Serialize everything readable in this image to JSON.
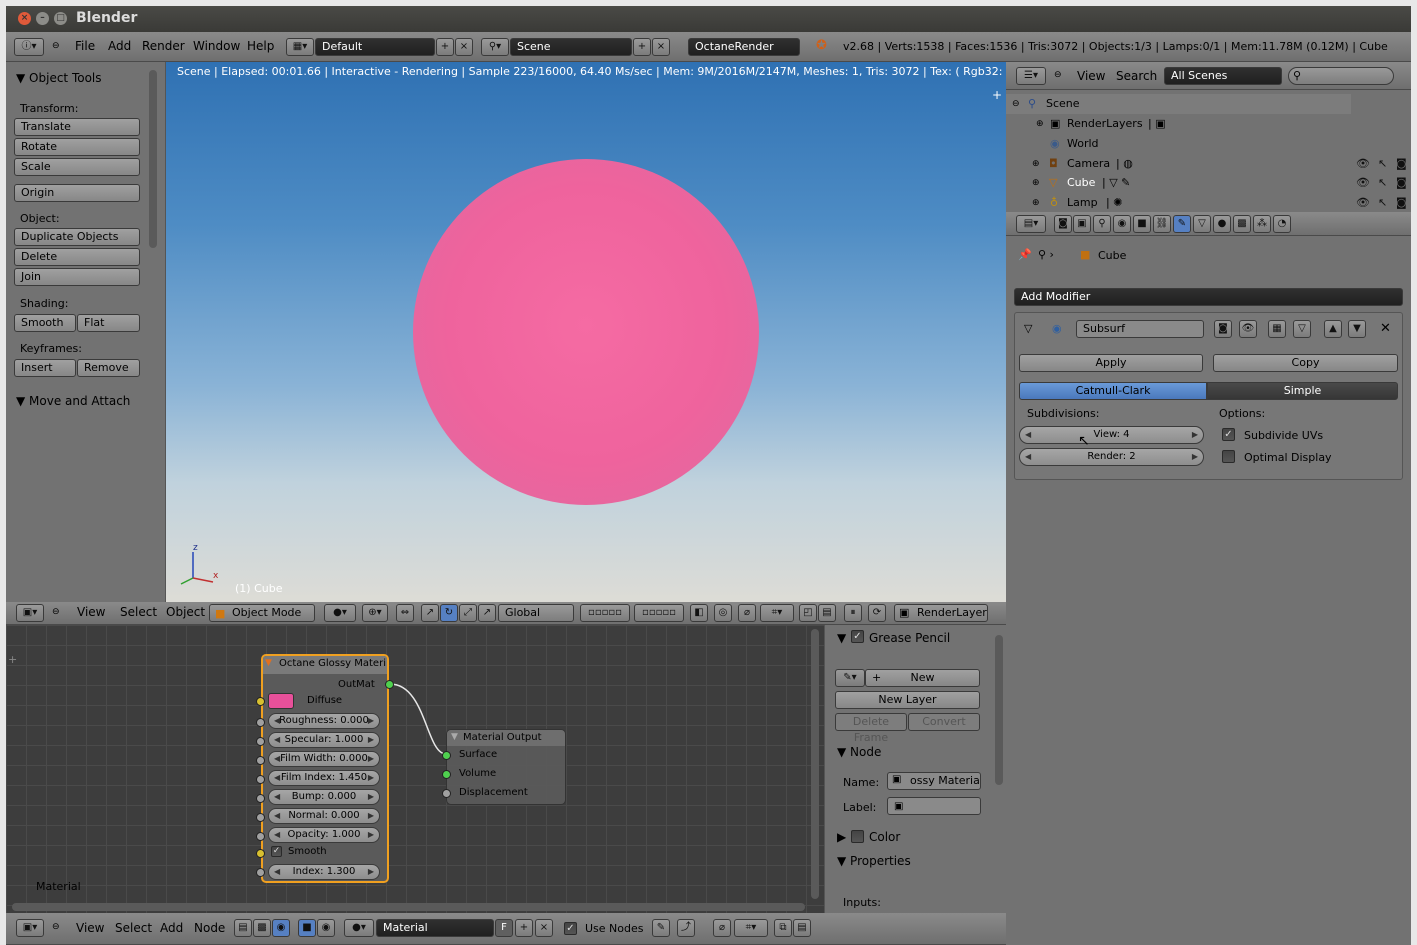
{
  "app": {
    "title": "Blender"
  },
  "topbar": {
    "menus": [
      "File",
      "Add",
      "Render",
      "Window",
      "Help"
    ],
    "screen_layout": "Default",
    "scene": "Scene",
    "render_engine": "OctaneRender",
    "stats": "v2.68 | Verts:1538 | Faces:1536 | Tris:3072 | Objects:1/3 | Lamps:0/1 | Mem:11.78M (0.12M) | Cube"
  },
  "tools_panel": {
    "title": "Object Tools",
    "transform_label": "Transform:",
    "translate": "Translate",
    "rotate": "Rotate",
    "scale": "Scale",
    "origin": "Origin",
    "object_label": "Object:",
    "duplicate": "Duplicate Objects",
    "delete": "Delete",
    "join": "Join",
    "shading_label": "Shading:",
    "smooth": "Smooth",
    "flat": "Flat",
    "keyframes_label": "Keyframes:",
    "insert": "Insert",
    "remove": "Remove",
    "move_attach": "Move and Attach"
  },
  "viewport": {
    "status": "Scene | Elapsed: 00:01.66 | Interactive - Rendering | Sample 223/16000, 64.40 Ms/sec | Mem: 9M/2016M/2147M, Meshes: 1, Tris: 3072 | Tex: ( Rgb32: 0/144, Rgb64",
    "object_label": "(1) Cube",
    "sphere_color": "#f06aa0",
    "axis_x": "x",
    "axis_z": "z"
  },
  "viewport_header": {
    "menus": [
      "View",
      "Select",
      "Object"
    ],
    "mode": "Object Mode",
    "orientation": "Global",
    "render_layer": "RenderLayer"
  },
  "outliner": {
    "menus": [
      "View",
      "Search"
    ],
    "filter": "All Scenes",
    "items": [
      {
        "label": "Scene"
      },
      {
        "label": "RenderLayers"
      },
      {
        "label": "World"
      },
      {
        "label": "Camera"
      },
      {
        "label": "Cube"
      },
      {
        "label": "Lamp"
      }
    ]
  },
  "properties": {
    "context_object": "Cube",
    "add_modifier": "Add Modifier",
    "modifier_name": "Subsurf",
    "apply": "Apply",
    "copy": "Copy",
    "catmull": "Catmull-Clark",
    "simple": "Simple",
    "subdivisions_label": "Subdivisions:",
    "options_label": "Options:",
    "view": "View: 4",
    "render": "Render: 2",
    "subdivide_uvs": "Subdivide UVs",
    "optimal_display": "Optimal Display",
    "subdivide_uvs_checked": true,
    "optimal_display_checked": false
  },
  "node_editor": {
    "glossy": {
      "title": "Octane Glossy Materi",
      "outmat": "OutMat",
      "diffuse": "Diffuse",
      "diffuse_color": "#e8509a",
      "params": [
        "Roughness: 0.000",
        "Specular: 1.000",
        "Film Width: 0.000",
        "Film Index: 1.450",
        "Bump: 0.000",
        "Normal: 0.000",
        "Opacity: 1.000"
      ],
      "smooth": "Smooth",
      "index": "Index: 1.300"
    },
    "output": {
      "title": "Material Output",
      "sockets": [
        "Surface",
        "Volume",
        "Displacement"
      ]
    },
    "tree_label": "Material"
  },
  "node_sidebar": {
    "grease_pencil": "Grease Pencil",
    "new": "New",
    "new_layer": "New Layer",
    "delete_frame": "Delete Frame",
    "convert": "Convert",
    "node_section": "Node",
    "name_label": "Name:",
    "name_value": "ossy Material",
    "label_label": "Label:",
    "color_section": "Color",
    "properties_section": "Properties",
    "inputs_label": "Inputs:"
  },
  "node_header": {
    "menus": [
      "View",
      "Select",
      "Add",
      "Node"
    ],
    "material": "Material",
    "fake_user": "F",
    "use_nodes": "Use Nodes"
  }
}
